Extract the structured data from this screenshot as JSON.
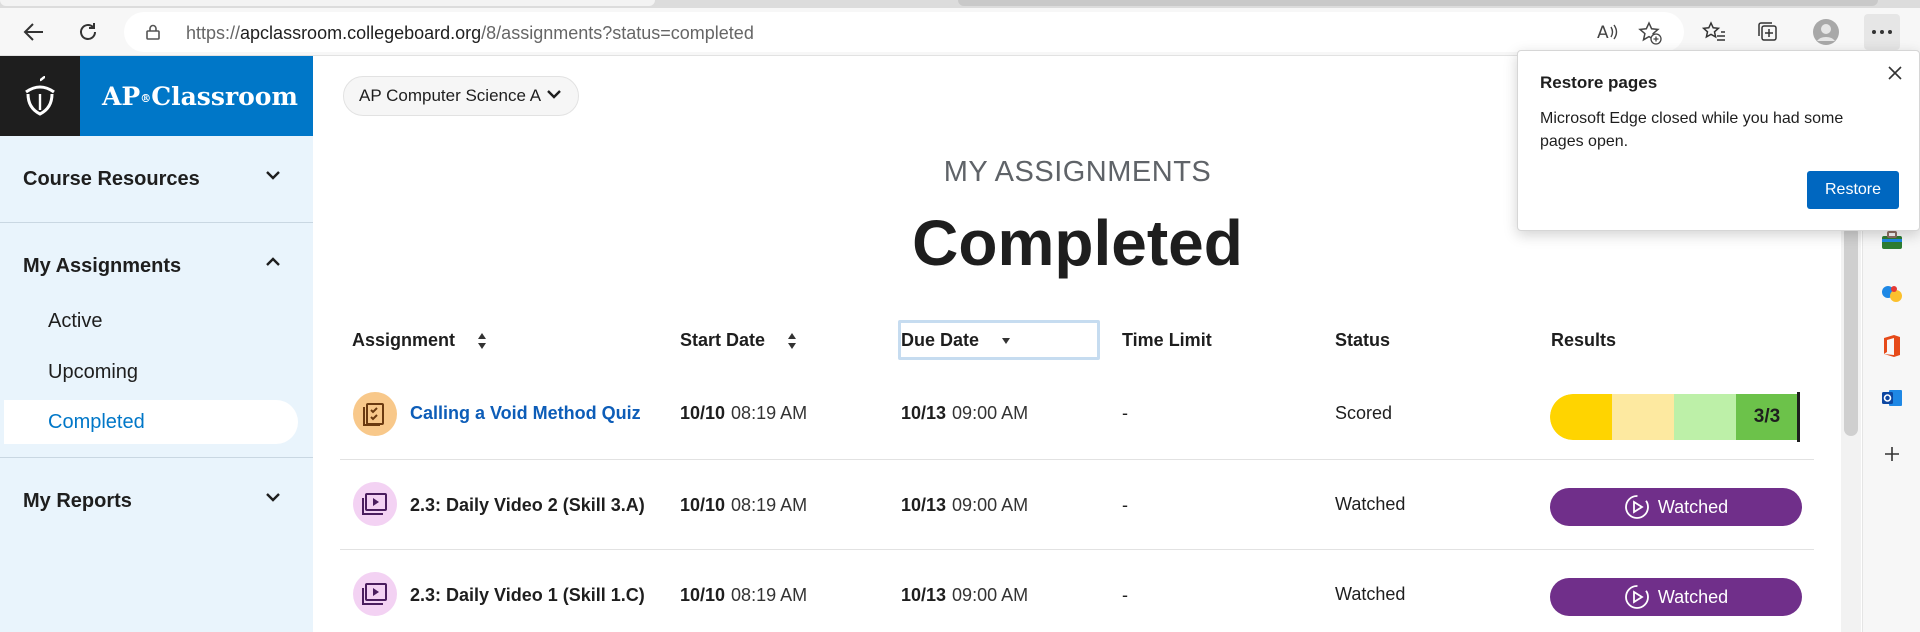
{
  "browser": {
    "url_prefix": "https://",
    "url_domain": "apclassroom.collegeboard.org",
    "url_path": "/8/assignments?status=completed"
  },
  "brand": {
    "name_ap": "AP",
    "name_sup": "®",
    "name_rest": "Classroom"
  },
  "nav": {
    "course_resources": "Course Resources",
    "my_assignments": "My Assignments",
    "active": "Active",
    "upcoming": "Upcoming",
    "completed": "Completed",
    "my_reports": "My Reports"
  },
  "course_selector": "AP Computer Science A",
  "header": {
    "kicker": "MY ASSIGNMENTS",
    "title": "Completed"
  },
  "table": {
    "columns": [
      "Assignment",
      "Start Date",
      "Due Date",
      "Time Limit",
      "Status",
      "Results"
    ],
    "rows": [
      {
        "name": "Calling a Void Method Quiz",
        "type": "quiz",
        "start_date": "10/10",
        "start_time": "08:19 AM",
        "due_date": "10/13",
        "due_time": "09:00 AM",
        "time_limit": "-",
        "status": "Scored",
        "result": "3/3"
      },
      {
        "name": "2.3: Daily Video 2 (Skill 3.A)",
        "type": "video",
        "start_date": "10/10",
        "start_time": "08:19 AM",
        "due_date": "10/13",
        "due_time": "09:00 AM",
        "time_limit": "-",
        "status": "Watched",
        "result": "Watched"
      },
      {
        "name": "2.3: Daily Video 1 (Skill 1.C)",
        "type": "video",
        "start_date": "10/10",
        "start_time": "08:19 AM",
        "due_date": "10/13",
        "due_time": "09:00 AM",
        "time_limit": "-",
        "status": "Watched",
        "result": "Watched"
      }
    ]
  },
  "popup": {
    "title": "Restore pages",
    "body": "Microsoft Edge closed while you had some pages open.",
    "button": "Restore"
  },
  "colors": {
    "brand_blue": "#0077c8",
    "watched_purple": "#702f8a",
    "edge_blue": "#0067c0"
  }
}
